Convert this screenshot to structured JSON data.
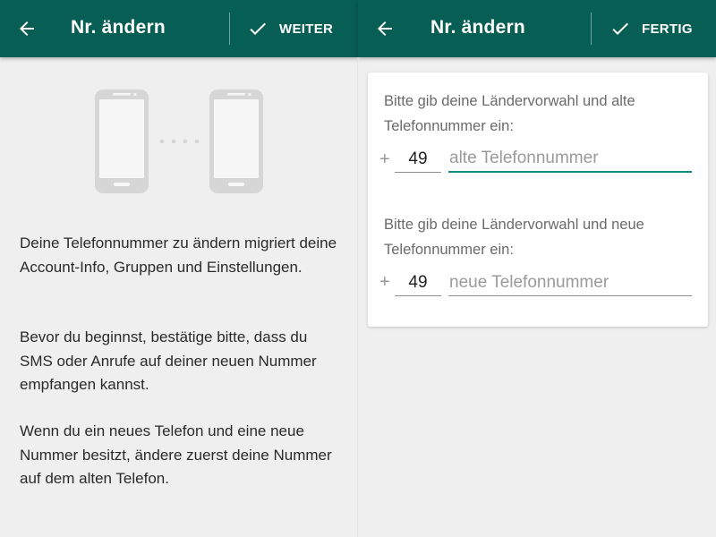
{
  "left_screen": {
    "header": {
      "title": "Nr. ändern",
      "action_label": "WEITER",
      "back_icon": "arrow-left-icon",
      "action_icon": "check-icon"
    },
    "illustration": {
      "left_icon": "phone-icon",
      "connector_icon": "dots-icon",
      "right_icon": "phone-icon"
    },
    "paragraphs": [
      "Deine Telefonnummer zu ändern migriert deine Account-Info, Gruppen und Einstellungen.",
      "Bevor du beginnst, bestätige bitte, dass du SMS oder Anrufe auf deiner neuen Nummer empfangen kannst.",
      "Wenn du ein neues Telefon und eine neue Nummer besitzt, ändere zuerst deine Nummer auf dem alten Telefon."
    ]
  },
  "right_screen": {
    "header": {
      "title": "Nr. ändern",
      "action_label": "FERTIG",
      "back_icon": "arrow-left-icon",
      "action_icon": "check-icon"
    },
    "form": {
      "old": {
        "prompt": "Bitte gib deine Ländervorwahl und alte Telefonnummer ein:",
        "plus": "+",
        "country_code": "49",
        "phone_placeholder": "alte Telefonnummer",
        "phone_value": ""
      },
      "new": {
        "prompt": "Bitte gib deine Ländervorwahl und neue Telefonnummer ein:",
        "plus": "+",
        "country_code": "49",
        "phone_placeholder": "neue Telefonnummer",
        "phone_value": ""
      }
    }
  },
  "colors": {
    "appbar": "#075e54",
    "accent": "#128c7e",
    "background": "#efefef",
    "card": "#ffffff",
    "illustration": "#d6d6d6"
  }
}
